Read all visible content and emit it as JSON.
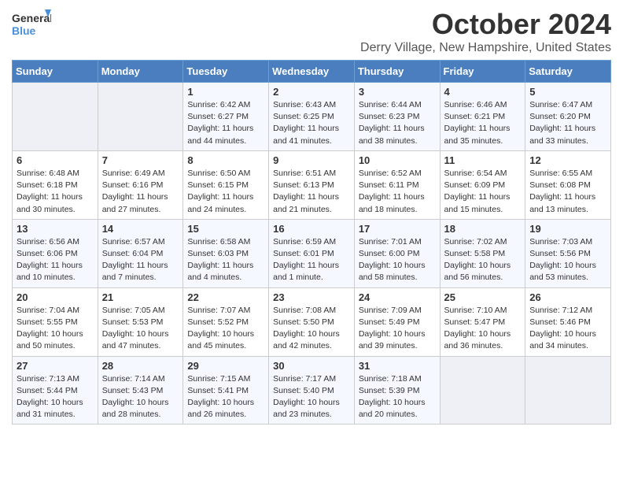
{
  "logo": {
    "general": "General",
    "blue": "Blue"
  },
  "title": "October 2024",
  "location": "Derry Village, New Hampshire, United States",
  "days_of_week": [
    "Sunday",
    "Monday",
    "Tuesday",
    "Wednesday",
    "Thursday",
    "Friday",
    "Saturday"
  ],
  "weeks": [
    [
      {
        "day": "",
        "info": ""
      },
      {
        "day": "",
        "info": ""
      },
      {
        "day": "1",
        "info": "Sunrise: 6:42 AM\nSunset: 6:27 PM\nDaylight: 11 hours and 44 minutes."
      },
      {
        "day": "2",
        "info": "Sunrise: 6:43 AM\nSunset: 6:25 PM\nDaylight: 11 hours and 41 minutes."
      },
      {
        "day": "3",
        "info": "Sunrise: 6:44 AM\nSunset: 6:23 PM\nDaylight: 11 hours and 38 minutes."
      },
      {
        "day": "4",
        "info": "Sunrise: 6:46 AM\nSunset: 6:21 PM\nDaylight: 11 hours and 35 minutes."
      },
      {
        "day": "5",
        "info": "Sunrise: 6:47 AM\nSunset: 6:20 PM\nDaylight: 11 hours and 33 minutes."
      }
    ],
    [
      {
        "day": "6",
        "info": "Sunrise: 6:48 AM\nSunset: 6:18 PM\nDaylight: 11 hours and 30 minutes."
      },
      {
        "day": "7",
        "info": "Sunrise: 6:49 AM\nSunset: 6:16 PM\nDaylight: 11 hours and 27 minutes."
      },
      {
        "day": "8",
        "info": "Sunrise: 6:50 AM\nSunset: 6:15 PM\nDaylight: 11 hours and 24 minutes."
      },
      {
        "day": "9",
        "info": "Sunrise: 6:51 AM\nSunset: 6:13 PM\nDaylight: 11 hours and 21 minutes."
      },
      {
        "day": "10",
        "info": "Sunrise: 6:52 AM\nSunset: 6:11 PM\nDaylight: 11 hours and 18 minutes."
      },
      {
        "day": "11",
        "info": "Sunrise: 6:54 AM\nSunset: 6:09 PM\nDaylight: 11 hours and 15 minutes."
      },
      {
        "day": "12",
        "info": "Sunrise: 6:55 AM\nSunset: 6:08 PM\nDaylight: 11 hours and 13 minutes."
      }
    ],
    [
      {
        "day": "13",
        "info": "Sunrise: 6:56 AM\nSunset: 6:06 PM\nDaylight: 11 hours and 10 minutes."
      },
      {
        "day": "14",
        "info": "Sunrise: 6:57 AM\nSunset: 6:04 PM\nDaylight: 11 hours and 7 minutes."
      },
      {
        "day": "15",
        "info": "Sunrise: 6:58 AM\nSunset: 6:03 PM\nDaylight: 11 hours and 4 minutes."
      },
      {
        "day": "16",
        "info": "Sunrise: 6:59 AM\nSunset: 6:01 PM\nDaylight: 11 hours and 1 minute."
      },
      {
        "day": "17",
        "info": "Sunrise: 7:01 AM\nSunset: 6:00 PM\nDaylight: 10 hours and 58 minutes."
      },
      {
        "day": "18",
        "info": "Sunrise: 7:02 AM\nSunset: 5:58 PM\nDaylight: 10 hours and 56 minutes."
      },
      {
        "day": "19",
        "info": "Sunrise: 7:03 AM\nSunset: 5:56 PM\nDaylight: 10 hours and 53 minutes."
      }
    ],
    [
      {
        "day": "20",
        "info": "Sunrise: 7:04 AM\nSunset: 5:55 PM\nDaylight: 10 hours and 50 minutes."
      },
      {
        "day": "21",
        "info": "Sunrise: 7:05 AM\nSunset: 5:53 PM\nDaylight: 10 hours and 47 minutes."
      },
      {
        "day": "22",
        "info": "Sunrise: 7:07 AM\nSunset: 5:52 PM\nDaylight: 10 hours and 45 minutes."
      },
      {
        "day": "23",
        "info": "Sunrise: 7:08 AM\nSunset: 5:50 PM\nDaylight: 10 hours and 42 minutes."
      },
      {
        "day": "24",
        "info": "Sunrise: 7:09 AM\nSunset: 5:49 PM\nDaylight: 10 hours and 39 minutes."
      },
      {
        "day": "25",
        "info": "Sunrise: 7:10 AM\nSunset: 5:47 PM\nDaylight: 10 hours and 36 minutes."
      },
      {
        "day": "26",
        "info": "Sunrise: 7:12 AM\nSunset: 5:46 PM\nDaylight: 10 hours and 34 minutes."
      }
    ],
    [
      {
        "day": "27",
        "info": "Sunrise: 7:13 AM\nSunset: 5:44 PM\nDaylight: 10 hours and 31 minutes."
      },
      {
        "day": "28",
        "info": "Sunrise: 7:14 AM\nSunset: 5:43 PM\nDaylight: 10 hours and 28 minutes."
      },
      {
        "day": "29",
        "info": "Sunrise: 7:15 AM\nSunset: 5:41 PM\nDaylight: 10 hours and 26 minutes."
      },
      {
        "day": "30",
        "info": "Sunrise: 7:17 AM\nSunset: 5:40 PM\nDaylight: 10 hours and 23 minutes."
      },
      {
        "day": "31",
        "info": "Sunrise: 7:18 AM\nSunset: 5:39 PM\nDaylight: 10 hours and 20 minutes."
      },
      {
        "day": "",
        "info": ""
      },
      {
        "day": "",
        "info": ""
      }
    ]
  ]
}
